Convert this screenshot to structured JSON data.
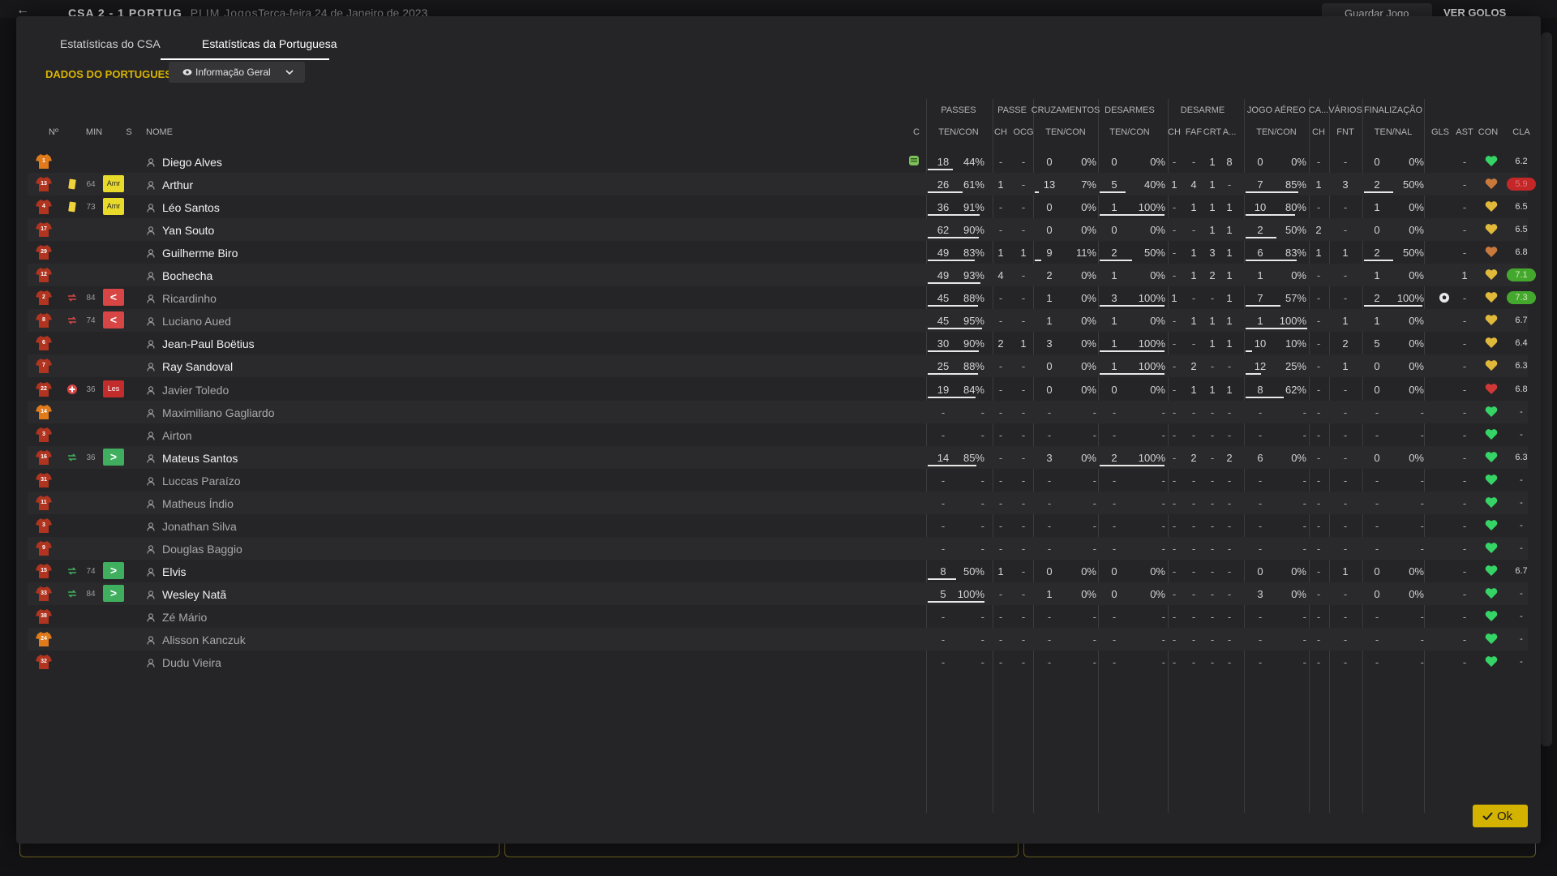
{
  "background": {
    "score": "CSA  2 - 1  PORTUG",
    "score_dim": "PLIM Jogos",
    "date": "Terça-feira 24 de Janeiro de 2023",
    "save_label": "Guardar Jogo",
    "goals_label": "VER GOLOS"
  },
  "tabs": [
    "Estatísticas do CSA",
    "Estatísticas da Portuguesa"
  ],
  "active_tab": 1,
  "section_title": "DADOS DO PORTUGUESA",
  "dropdown_label": "Informação Geral",
  "headers": {
    "groups": [
      "PASSES",
      "PASSE",
      "CRUZAMENTOS",
      "DESARMES",
      "DESARME",
      "JOGO AÉREO",
      "CA...",
      "VÁRIOS",
      "FINALIZAÇÃO"
    ],
    "subs": [
      "Nº",
      "MIN",
      "S",
      "NOME",
      "C",
      "TEN/CON",
      "CH",
      "OCG",
      "TEN/CON",
      "TEN/CON",
      "CH",
      "FAF",
      "CRT",
      "A...",
      "TEN/CON",
      "CH",
      "FNT",
      "TEN/NAL",
      "GLS",
      "AST",
      "CON",
      "CLA"
    ]
  },
  "players": [
    {
      "no": "1",
      "shirt": "orange",
      "name": "Diego Alves",
      "dim": false,
      "min": "",
      "ev": "",
      "badge": "",
      "badge_type": "",
      "c_icon": true,
      "p": [
        "18",
        "44%"
      ],
      "pb": 0.44,
      "ch": "-",
      "ocg": "-",
      "cr": [
        "0",
        "0%"
      ],
      "crb": 0,
      "de": [
        "0",
        "0%"
      ],
      "deb": 0,
      "dch": "-",
      "faf": "-",
      "crt": "1",
      "a": "8",
      "ja": [
        "0",
        "0%"
      ],
      "jab": 0,
      "ca": "-",
      "fnt": "-",
      "fi": [
        "0",
        "0%"
      ],
      "fib": 0,
      "gls": "",
      "ast": "-",
      "con": "green",
      "cla": "6.2",
      "cla_style": ""
    },
    {
      "no": "13",
      "shirt": "red",
      "name": "Arthur",
      "dim": false,
      "min": "64",
      "ev": "yellow",
      "badge": "Amr",
      "badge_type": "amr",
      "c_icon": false,
      "p": [
        "26",
        "61%"
      ],
      "pb": 0.61,
      "ch": "1",
      "ocg": "-",
      "cr": [
        "13",
        "7%"
      ],
      "crb": 0.07,
      "de": [
        "5",
        "40%"
      ],
      "deb": 0.4,
      "dch": "1",
      "faf": "4",
      "crt": "1",
      "a": "-",
      "ja": [
        "7",
        "85%"
      ],
      "jab": 0.85,
      "ca": "1",
      "fnt": "3",
      "fi": [
        "2",
        "50%"
      ],
      "fib": 0.5,
      "gls": "",
      "ast": "-",
      "con": "orange",
      "cla": "5.9",
      "cla_style": "red"
    },
    {
      "no": "4",
      "shirt": "red",
      "name": "Léo Santos",
      "dim": false,
      "min": "73",
      "ev": "yellow",
      "badge": "Amr",
      "badge_type": "amr",
      "c_icon": false,
      "p": [
        "36",
        "91%"
      ],
      "pb": 0.91,
      "ch": "-",
      "ocg": "-",
      "cr": [
        "0",
        "0%"
      ],
      "crb": 0,
      "de": [
        "1",
        "100%"
      ],
      "deb": 1,
      "dch": "-",
      "faf": "1",
      "crt": "1",
      "a": "1",
      "ja": [
        "10",
        "80%"
      ],
      "jab": 0.8,
      "ca": "-",
      "fnt": "-",
      "fi": [
        "1",
        "0%"
      ],
      "fib": 0,
      "gls": "",
      "ast": "-",
      "con": "yellow",
      "cla": "6.5",
      "cla_style": ""
    },
    {
      "no": "17",
      "shirt": "red",
      "name": "Yan Souto",
      "dim": false,
      "min": "",
      "ev": "",
      "badge": "",
      "badge_type": "",
      "c_icon": false,
      "p": [
        "62",
        "90%"
      ],
      "pb": 0.9,
      "ch": "-",
      "ocg": "-",
      "cr": [
        "0",
        "0%"
      ],
      "crb": 0,
      "de": [
        "0",
        "0%"
      ],
      "deb": 0,
      "dch": "-",
      "faf": "-",
      "crt": "1",
      "a": "1",
      "ja": [
        "2",
        "50%"
      ],
      "jab": 0.5,
      "ca": "2",
      "fnt": "-",
      "fi": [
        "0",
        "0%"
      ],
      "fib": 0,
      "gls": "",
      "ast": "-",
      "con": "yellow",
      "cla": "6.5",
      "cla_style": ""
    },
    {
      "no": "29",
      "shirt": "red",
      "name": "Guilherme Biro",
      "dim": false,
      "min": "",
      "ev": "",
      "badge": "",
      "badge_type": "",
      "c_icon": false,
      "p": [
        "49",
        "83%"
      ],
      "pb": 0.83,
      "ch": "1",
      "ocg": "1",
      "cr": [
        "9",
        "11%"
      ],
      "crb": 0.11,
      "de": [
        "2",
        "50%"
      ],
      "deb": 0.5,
      "dch": "-",
      "faf": "1",
      "crt": "3",
      "a": "1",
      "ja": [
        "6",
        "83%"
      ],
      "jab": 0.83,
      "ca": "1",
      "fnt": "1",
      "fi": [
        "2",
        "50%"
      ],
      "fib": 0.5,
      "gls": "",
      "ast": "-",
      "con": "orange",
      "cla": "6.8",
      "cla_style": ""
    },
    {
      "no": "12",
      "shirt": "red",
      "name": "Bochecha",
      "dim": false,
      "min": "",
      "ev": "",
      "badge": "",
      "badge_type": "",
      "c_icon": false,
      "p": [
        "49",
        "93%"
      ],
      "pb": 0.93,
      "ch": "4",
      "ocg": "-",
      "cr": [
        "2",
        "0%"
      ],
      "crb": 0,
      "de": [
        "1",
        "0%"
      ],
      "deb": 0,
      "dch": "-",
      "faf": "1",
      "crt": "2",
      "a": "1",
      "ja": [
        "1",
        "0%"
      ],
      "jab": 0,
      "ca": "-",
      "fnt": "-",
      "fi": [
        "1",
        "0%"
      ],
      "fib": 0,
      "gls": "",
      "ast": "1",
      "con": "yellow",
      "cla": "7.1",
      "cla_style": "green"
    },
    {
      "no": "2",
      "shirt": "red",
      "name": "Ricardinho",
      "dim": true,
      "min": "84",
      "ev": "subout",
      "badge": "<",
      "badge_type": "sub-out",
      "c_icon": false,
      "p": [
        "45",
        "88%"
      ],
      "pb": 0.88,
      "ch": "-",
      "ocg": "-",
      "cr": [
        "1",
        "0%"
      ],
      "crb": 0,
      "de": [
        "3",
        "100%"
      ],
      "deb": 1,
      "dch": "1",
      "faf": "-",
      "crt": "-",
      "a": "1",
      "ja": [
        "7",
        "57%"
      ],
      "jab": 0.57,
      "ca": "-",
      "fnt": "-",
      "fi": [
        "2",
        "100%"
      ],
      "fib": 1,
      "gls": "ball",
      "ast": "-",
      "con": "yellow",
      "cla": "7.3",
      "cla_style": "green"
    },
    {
      "no": "8",
      "shirt": "red",
      "name": "Luciano Aued",
      "dim": true,
      "min": "74",
      "ev": "subout",
      "badge": "<",
      "badge_type": "sub-out",
      "c_icon": false,
      "p": [
        "45",
        "95%"
      ],
      "pb": 0.95,
      "ch": "-",
      "ocg": "-",
      "cr": [
        "1",
        "0%"
      ],
      "crb": 0,
      "de": [
        "1",
        "0%"
      ],
      "deb": 0,
      "dch": "-",
      "faf": "1",
      "crt": "1",
      "a": "1",
      "ja": [
        "1",
        "100%"
      ],
      "jab": 1,
      "ca": "-",
      "fnt": "1",
      "fi": [
        "1",
        "0%"
      ],
      "fib": 0,
      "gls": "",
      "ast": "-",
      "con": "yellow",
      "cla": "6.7",
      "cla_style": ""
    },
    {
      "no": "6",
      "shirt": "red",
      "name": "Jean-Paul Boëtius",
      "dim": false,
      "min": "",
      "ev": "",
      "badge": "",
      "badge_type": "",
      "c_icon": false,
      "p": [
        "30",
        "90%"
      ],
      "pb": 0.9,
      "ch": "2",
      "ocg": "1",
      "cr": [
        "3",
        "0%"
      ],
      "crb": 0,
      "de": [
        "1",
        "100%"
      ],
      "deb": 1,
      "dch": "-",
      "faf": "-",
      "crt": "1",
      "a": "1",
      "ja": [
        "10",
        "10%"
      ],
      "jab": 0.1,
      "ca": "-",
      "fnt": "2",
      "fi": [
        "5",
        "0%"
      ],
      "fib": 0,
      "gls": "",
      "ast": "-",
      "con": "yellow",
      "cla": "6.4",
      "cla_style": ""
    },
    {
      "no": "7",
      "shirt": "red",
      "name": "Ray Sandoval",
      "dim": false,
      "min": "",
      "ev": "",
      "badge": "",
      "badge_type": "",
      "c_icon": false,
      "p": [
        "25",
        "88%"
      ],
      "pb": 0.88,
      "ch": "-",
      "ocg": "-",
      "cr": [
        "0",
        "0%"
      ],
      "crb": 0,
      "de": [
        "1",
        "100%"
      ],
      "deb": 1,
      "dch": "-",
      "faf": "2",
      "crt": "-",
      "a": "-",
      "ja": [
        "12",
        "25%"
      ],
      "jab": 0.25,
      "ca": "-",
      "fnt": "1",
      "fi": [
        "0",
        "0%"
      ],
      "fib": 0,
      "gls": "",
      "ast": "-",
      "con": "yellow",
      "cla": "6.3",
      "cla_style": ""
    },
    {
      "no": "22",
      "shirt": "red",
      "name": "Javier Toledo",
      "dim": true,
      "min": "36",
      "ev": "injury",
      "badge": "Les",
      "badge_type": "les",
      "c_icon": false,
      "p": [
        "19",
        "84%"
      ],
      "pb": 0.84,
      "ch": "-",
      "ocg": "-",
      "cr": [
        "0",
        "0%"
      ],
      "crb": 0,
      "de": [
        "0",
        "0%"
      ],
      "deb": 0,
      "dch": "-",
      "faf": "1",
      "crt": "1",
      "a": "1",
      "ja": [
        "8",
        "62%"
      ],
      "jab": 0.62,
      "ca": "-",
      "fnt": "-",
      "fi": [
        "0",
        "0%"
      ],
      "fib": 0,
      "gls": "",
      "ast": "-",
      "con": "red",
      "cla": "6.8",
      "cla_style": ""
    },
    {
      "no": "14",
      "shirt": "orange",
      "name": "Maximiliano Gagliardo",
      "dim": true,
      "min": "",
      "ev": "",
      "badge": "",
      "badge_type": "",
      "c_icon": false,
      "empty": true,
      "con": "green",
      "cla": "-"
    },
    {
      "no": "3",
      "shirt": "red",
      "name": "Airton",
      "dim": true,
      "min": "",
      "ev": "",
      "badge": "",
      "badge_type": "",
      "c_icon": false,
      "empty": true,
      "con": "green",
      "cla": "-"
    },
    {
      "no": "16",
      "shirt": "red",
      "name": "Mateus Santos",
      "dim": false,
      "min": "36",
      "ev": "subin",
      "badge": ">",
      "badge_type": "sub-in",
      "c_icon": false,
      "p": [
        "14",
        "85%"
      ],
      "pb": 0.85,
      "ch": "-",
      "ocg": "-",
      "cr": [
        "3",
        "0%"
      ],
      "crb": 0,
      "de": [
        "2",
        "100%"
      ],
      "deb": 1,
      "dch": "-",
      "faf": "2",
      "crt": "-",
      "a": "2",
      "ja": [
        "6",
        "0%"
      ],
      "jab": 0,
      "ca": "-",
      "fnt": "-",
      "fi": [
        "0",
        "0%"
      ],
      "fib": 0,
      "gls": "",
      "ast": "-",
      "con": "green",
      "cla": "6.3",
      "cla_style": ""
    },
    {
      "no": "31",
      "shirt": "red",
      "name": "Luccas Paraízo",
      "dim": true,
      "min": "",
      "ev": "",
      "badge": "",
      "badge_type": "",
      "c_icon": false,
      "empty": true,
      "con": "green",
      "cla": "-"
    },
    {
      "no": "11",
      "shirt": "red",
      "name": "Matheus Índio",
      "dim": true,
      "min": "",
      "ev": "",
      "badge": "",
      "badge_type": "",
      "c_icon": false,
      "empty": true,
      "con": "green",
      "cla": "-"
    },
    {
      "no": "3",
      "shirt": "red",
      "name": "Jonathan Silva",
      "dim": true,
      "min": "",
      "ev": "",
      "badge": "",
      "badge_type": "",
      "c_icon": false,
      "empty": true,
      "con": "green",
      "cla": "-"
    },
    {
      "no": "9",
      "shirt": "red",
      "name": "Douglas Baggio",
      "dim": true,
      "min": "",
      "ev": "",
      "badge": "",
      "badge_type": "",
      "c_icon": false,
      "empty": true,
      "con": "green",
      "cla": "-"
    },
    {
      "no": "15",
      "shirt": "red",
      "name": "Elvis",
      "dim": false,
      "min": "74",
      "ev": "subin",
      "badge": ">",
      "badge_type": "sub-in",
      "c_icon": false,
      "p": [
        "8",
        "50%"
      ],
      "pb": 0.5,
      "ch": "1",
      "ocg": "-",
      "cr": [
        "0",
        "0%"
      ],
      "crb": 0,
      "de": [
        "0",
        "0%"
      ],
      "deb": 0,
      "dch": "-",
      "faf": "-",
      "crt": "-",
      "a": "-",
      "ja": [
        "0",
        "0%"
      ],
      "jab": 0,
      "ca": "-",
      "fnt": "1",
      "fi": [
        "0",
        "0%"
      ],
      "fib": 0,
      "gls": "",
      "ast": "-",
      "con": "green",
      "cla": "6.7",
      "cla_style": ""
    },
    {
      "no": "33",
      "shirt": "red",
      "name": "Wesley Natã",
      "dim": false,
      "min": "84",
      "ev": "subin",
      "badge": ">",
      "badge_type": "sub-in",
      "c_icon": false,
      "p": [
        "5",
        "100%"
      ],
      "pb": 1,
      "ch": "-",
      "ocg": "-",
      "cr": [
        "1",
        "0%"
      ],
      "crb": 0,
      "de": [
        "0",
        "0%"
      ],
      "deb": 0,
      "dch": "-",
      "faf": "-",
      "crt": "-",
      "a": "-",
      "ja": [
        "3",
        "0%"
      ],
      "jab": 0,
      "ca": "-",
      "fnt": "-",
      "fi": [
        "0",
        "0%"
      ],
      "fib": 0,
      "gls": "",
      "ast": "-",
      "con": "green",
      "cla": "-",
      "cla_style": ""
    },
    {
      "no": "38",
      "shirt": "red",
      "name": "Zé Mário",
      "dim": true,
      "min": "",
      "ev": "",
      "badge": "",
      "badge_type": "",
      "c_icon": false,
      "empty": true,
      "con": "green",
      "cla": "-"
    },
    {
      "no": "24",
      "shirt": "orange",
      "name": "Alisson Kanczuk",
      "dim": true,
      "min": "",
      "ev": "",
      "badge": "",
      "badge_type": "",
      "c_icon": false,
      "empty": true,
      "con": "green",
      "cla": "-"
    },
    {
      "no": "32",
      "shirt": "red",
      "name": "Dudu Vieira",
      "dim": true,
      "min": "",
      "ev": "",
      "badge": "",
      "badge_type": "",
      "c_icon": false,
      "empty": true,
      "con": "green",
      "cla": "-"
    }
  ],
  "ok_label": "Ok",
  "colors": {
    "accent": "#d4b300",
    "red_shirt": "#b0341f",
    "orange_shirt": "#e07a1a",
    "green": "#45a82e",
    "red": "#c42727"
  }
}
